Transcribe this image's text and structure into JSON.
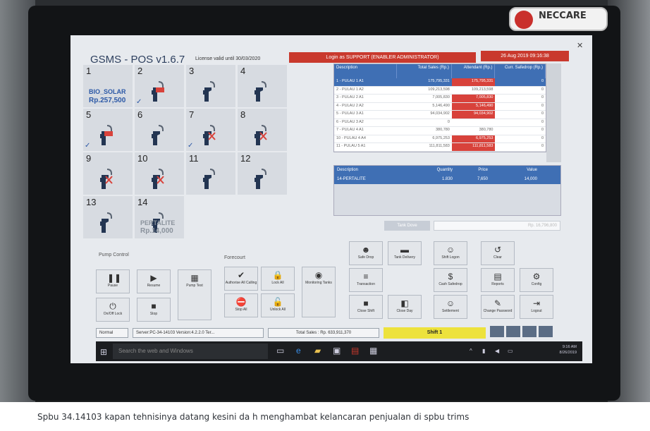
{
  "brand": {
    "name": "NECCARE"
  },
  "app": {
    "title": "GSMS - POS v1.6.7",
    "license": "License valid until 30/03/2020",
    "login": "Login as SUPPORT (ENABLER ADMINISTRATOR)",
    "date": "26 Aug 2019 09:16:38"
  },
  "pumps": [
    {
      "num": "1",
      "fuel": "BIO_SOLAR",
      "price": "Rp.257,500"
    },
    {
      "num": "2"
    },
    {
      "num": "3"
    },
    {
      "num": "4"
    },
    {
      "num": "5"
    },
    {
      "num": "6"
    },
    {
      "num": "7"
    },
    {
      "num": "8"
    },
    {
      "num": "9"
    },
    {
      "num": "10"
    },
    {
      "num": "11"
    },
    {
      "num": "12"
    },
    {
      "num": "13"
    },
    {
      "num": "14",
      "fuel": "PERTALITE",
      "price": "Rp.14,000"
    }
  ],
  "shift_table": {
    "headers": [
      "Description",
      "Total Sales (Rp.)",
      "Attendant (Rp.)",
      "Curr. Safedrop (Rp.)"
    ],
    "rows": [
      [
        "1 - PULAU 1 A1",
        "175,795,331",
        "175,795,331",
        "0"
      ],
      [
        "2 - PULAU 1 A2",
        "109,213,598",
        "109,213,598",
        "0"
      ],
      [
        "3 - PULAU 2 A1",
        "7,005,830",
        "7,005,830",
        "0"
      ],
      [
        "4 - PULAU 2 A2",
        "5,146,490",
        "5,146,490",
        "0"
      ],
      [
        "5 - PULAU 3 A1",
        "94,034,902",
        "94,034,902",
        "0"
      ],
      [
        "6 - PULAU 3 A2",
        "0",
        "",
        "0"
      ],
      [
        "7 - PULAU 4 A1",
        "380,780",
        "380,780",
        "0"
      ],
      [
        "10 - PULAU 4 A4",
        "6,975,253",
        "6,975,253",
        "0"
      ],
      [
        "11 - PULAU 5 A1",
        "111,811,583",
        "111,811,583",
        "0"
      ]
    ]
  },
  "trans_table": {
    "headers": [
      "Description",
      "Quantity",
      "Price",
      "Value"
    ],
    "rows": [
      [
        "14-PERTALITE",
        "1.830",
        "7,650",
        "14,000"
      ]
    ]
  },
  "tank": {
    "button": "Tank Dove",
    "value": "Rp. 16,796,800"
  },
  "groups": {
    "pump_control": "Pump Control",
    "forecourt": "Forecourt"
  },
  "pump_buttons": [
    "Pause",
    "Resume",
    "On/Off Lock",
    "Stop",
    "Pump Test"
  ],
  "forecourt_buttons": [
    "Authorise All Calling",
    "Lock All",
    "Stop All",
    "Unlock All",
    "Monitoring Tanks"
  ],
  "right_buttons": [
    "Safe Drop",
    "Tank Delivery",
    "Shift Logon",
    "Clear",
    "Transaction",
    "Cash Safedrop",
    "Reports",
    "Config",
    "Close Shift",
    "Close Day",
    "Settlement",
    "Change Password",
    "Logout"
  ],
  "status": {
    "mode": "Normal",
    "server": "Server:PC-34-14103  Version:4.2.2.0  Ter...",
    "total": "Total Sales : Rp. 633,911,370",
    "shift": "Shift 1"
  },
  "taskbar": {
    "search": "Search the web and Windows",
    "time": "9:16 AM",
    "date": "8/26/2019"
  },
  "caption": "Spbu 34.14103 kapan tehnisinya datang kesini da h menghambat kelancaran penjualan di spbu trims",
  "colors": {
    "accent_blue": "#3f6fb4",
    "alert_red": "#c9392d",
    "shift_yellow": "#ede23c"
  }
}
